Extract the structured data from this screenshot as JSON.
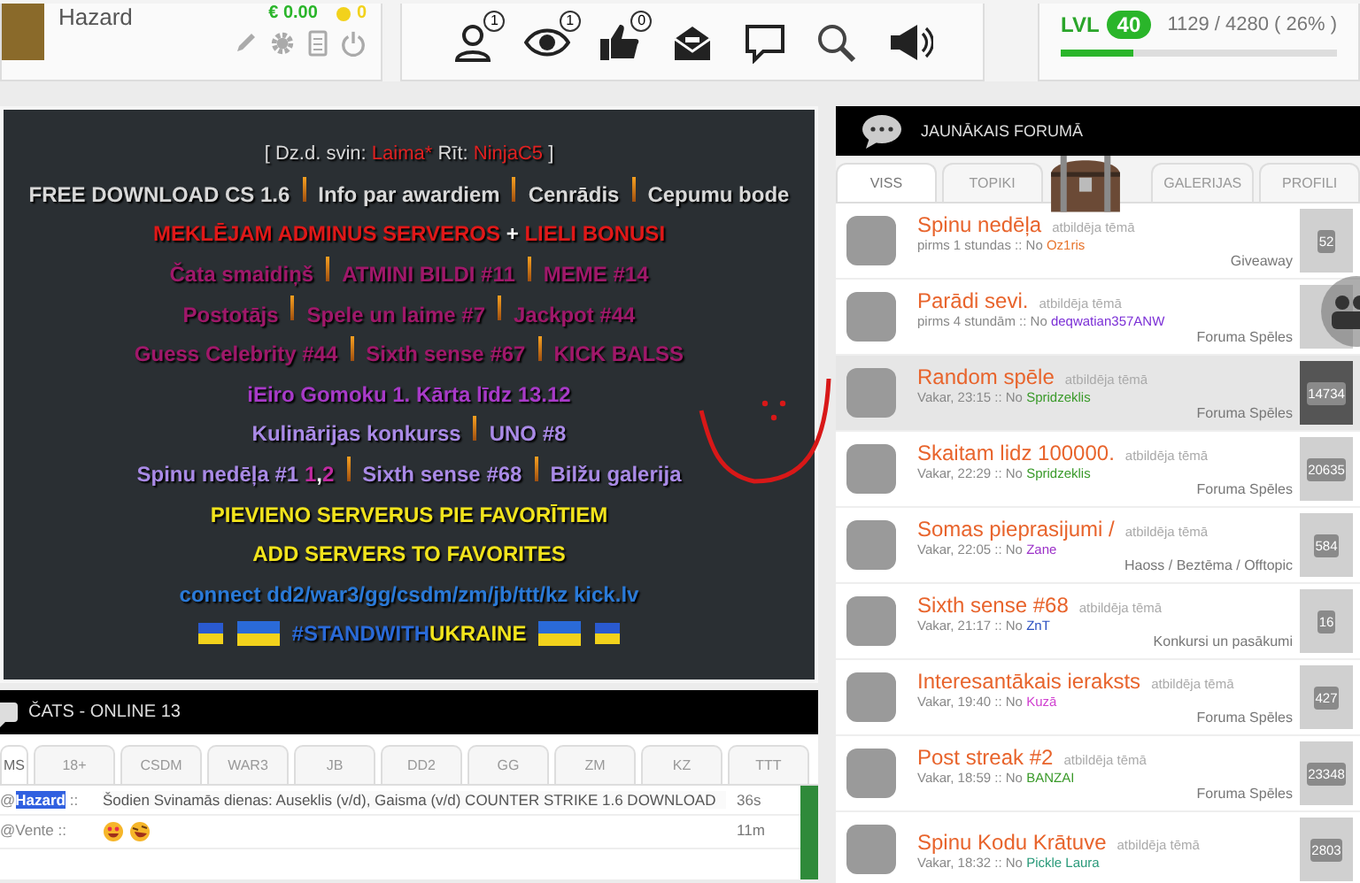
{
  "profile": {
    "name": "Hazard",
    "money": "€ 0.00",
    "coins": "0"
  },
  "nav_icons": [
    {
      "kind": "user",
      "badge": "1"
    },
    {
      "kind": "eye",
      "badge": "1"
    },
    {
      "kind": "like",
      "badge": "0"
    },
    {
      "kind": "mail"
    },
    {
      "kind": "chat"
    },
    {
      "kind": "search"
    },
    {
      "kind": "megaphone"
    }
  ],
  "level_box": {
    "label": "LVL",
    "value": "40",
    "progress": "1129 / 4280 ( 26% )",
    "level": 0.26
  },
  "banner": [
    [
      [
        {
          "text": "[ Dz.d. svin: ",
          "color": "#d8d8d8"
        },
        {
          "text": "Laima*",
          "color": "#e02020"
        },
        {
          "text": " Rīt: ",
          "color": "#d8d8d8"
        },
        {
          "text": "NinjaC5",
          "color": "#e02020"
        },
        {
          "text": " ]",
          "color": "#d8d8d8"
        }
      ]
    ],
    [
      [
        {
          "text": "FREE DOWNLOAD CS 1.6",
          "color": "#d8d8d8"
        }
      ],
      [
        {
          "text": "Info par awardiem",
          "color": "#d8d8d8"
        }
      ],
      [
        {
          "text": "Cenrādis",
          "color": "#d8d8d8"
        }
      ],
      [
        {
          "text": "Cepumu bode",
          "color": "#d8d8d8"
        }
      ]
    ],
    [
      [
        {
          "text": "MEKLĒJAM ADMINUS SERVEROS",
          "color": "#e01818"
        },
        {
          "text": " + ",
          "color": "#ffffff"
        },
        {
          "text": "LIELI BONUSI",
          "color": "#e01818"
        }
      ]
    ],
    [
      [
        {
          "text": "Čata smaidiņš",
          "color": "#a0186a"
        }
      ],
      [
        {
          "text": "ATMINI BILDI #11",
          "color": "#a0186a"
        }
      ],
      [
        {
          "text": "MEME #14",
          "color": "#a0186a"
        }
      ]
    ],
    [
      [
        {
          "text": "Postotājs",
          "color": "#a0186a"
        }
      ],
      [
        {
          "text": "Spele un laime #7",
          "color": "#a0186a"
        }
      ],
      [
        {
          "text": "Jackpot #44",
          "color": "#a0186a"
        }
      ]
    ],
    [
      [
        {
          "text": "Guess Celebrity #44",
          "color": "#a0186a"
        }
      ],
      [
        {
          "text": "Sixth sense #67",
          "color": "#a0186a"
        }
      ],
      [
        {
          "text": "KICK BALSS",
          "color": "#a0186a"
        }
      ]
    ],
    [
      [
        {
          "text": "iEiro Gomoku 1. Kārta līdz 13.12",
          "color": "#a83ac8"
        }
      ]
    ],
    [
      [
        {
          "text": "Kulinārijas konkurss",
          "color": "#a98ae6"
        }
      ],
      [
        {
          "text": "UNO #8",
          "color": "#a98ae6"
        }
      ]
    ],
    [
      [
        {
          "text": "Spinu nedēļa #1 ",
          "color": "#a98ae6"
        },
        {
          "text": "1",
          "color": "#c02aa0"
        },
        {
          "text": ",",
          "color": "#ffffff"
        },
        {
          "text": "2",
          "color": "#c02aa0"
        }
      ],
      [
        {
          "text": "Sixth sense #68",
          "color": "#a98ae6"
        }
      ],
      [
        {
          "text": "Bilžu galerija",
          "color": "#a98ae6"
        }
      ]
    ],
    [
      [
        {
          "text": "PIEVIENO SERVERUS PIE FAVORĪTIEM",
          "color": "#f2e41c"
        }
      ]
    ],
    [
      [
        {
          "text": "ADD SERVERS TO FAVORITES",
          "color": "#f2e41c"
        }
      ]
    ],
    [
      [
        {
          "text": "connect dd2/war3/gg/csdm/zm/jb/ttt/kz kick.lv",
          "color": "#2a7ad8"
        }
      ]
    ]
  ],
  "ukraine": [
    {
      "text": "#STANDWITH",
      "color": "#2a6ad8"
    },
    {
      "text": "UKRAINE",
      "color": "#f2e41c"
    }
  ],
  "chat": {
    "title": "ČATS - ONLINE 13",
    "tabs": [
      {
        "label": "MS",
        "selected": true
      },
      {
        "label": "18+",
        "selected": false
      },
      {
        "label": "CSDM",
        "selected": false
      },
      {
        "label": "WAR3",
        "selected": false
      },
      {
        "label": "JB",
        "selected": false
      },
      {
        "label": "DD2",
        "selected": false
      },
      {
        "label": "GG",
        "selected": false
      },
      {
        "label": "ZM",
        "selected": false
      },
      {
        "label": "KZ",
        "selected": false
      },
      {
        "label": "TTT",
        "selected": false
      }
    ],
    "messages": [
      {
        "prefix": "@",
        "user": "Hazard",
        "suffix": "::",
        "highlighted": true,
        "text": "Šodien Svinamās dienas: Auseklis (v/d), Gaisma (v/d) COUNTER STRIKE 1.6 DOWNLOAD",
        "time": "36s",
        "emojis": false
      },
      {
        "prefix": "@",
        "user": "Vente",
        "suffix": "::",
        "highlighted": false,
        "time": "11m",
        "emojis": true
      }
    ]
  },
  "forum": {
    "title": "JAUNĀKAIS FORUMĀ",
    "tabs": [
      {
        "label": "VISS",
        "selected": true
      },
      {
        "label": "TOPIKI",
        "selected": false
      },
      {
        "label": "GALERIJAS",
        "selected": false
      },
      {
        "label": "PROFILI",
        "selected": false
      }
    ],
    "posts": [
      {
        "title": "Spinu nedēļa",
        "action": "atbildēja tēmā",
        "time": "pirms 1 stundas",
        "by": ":: No",
        "user": "Oz1ris",
        "color": "#e8742c",
        "category": "Giveaway",
        "count": "52",
        "selected": false
      },
      {
        "title": "Parādi sevi.",
        "action": "atbildēja tēmā",
        "time": "pirms 4 stundām",
        "by": ":: No",
        "user": "deqwatian357ANW",
        "color": "#7b2fd6",
        "category": "Foruma Spēles",
        "selected": false
      },
      {
        "title": "Random spēle",
        "action": "atbildēja tēmā",
        "time": "Vakar, 23:15",
        "by": ":: No",
        "user": "Spridzeklis",
        "color": "#3a9a2a",
        "category": "Foruma Spēles",
        "count": "14734",
        "selected": true
      },
      {
        "title": "Skaitam lidz 100000.",
        "action": "atbildēja tēmā",
        "time": "Vakar, 22:29",
        "by": ":: No",
        "user": "Spridzeklis",
        "color": "#3a9a2a",
        "category": "Foruma Spēles",
        "count": "20635",
        "selected": false
      },
      {
        "title": "Somas pieprasijumi /",
        "action": "atbildēja tēmā",
        "time": "Vakar, 22:05",
        "by": ":: No",
        "user": "Zane",
        "color": "#9b30c8",
        "category": "Haoss / Beztēma / Offtopic",
        "count": "584",
        "selected": false
      },
      {
        "title": "Sixth sense #68",
        "action": "atbildēja tēmā",
        "time": "Vakar, 21:17",
        "by": ":: No",
        "user": "ZnT",
        "color": "#2a4fc0",
        "category": "Konkursi un pasākumi",
        "count": "16",
        "selected": false
      },
      {
        "title": "Interesantākais ieraksts",
        "action": "atbildēja tēmā",
        "time": "Vakar, 19:40",
        "by": ":: No",
        "user": "Kuzā",
        "color": "#d040d0",
        "category": "Foruma Spēles",
        "count": "427",
        "selected": false
      },
      {
        "title": "Post streak #2",
        "action": "atbildēja tēmā",
        "time": "Vakar, 18:59",
        "by": ":: No",
        "user": "BANZAI",
        "color": "#3a9a2a",
        "category": "Foruma Spēles",
        "count": "23348",
        "selected": false
      },
      {
        "title": "Spinu Kodu Krātuve",
        "action": "atbildēja tēmā",
        "time": "Vakar, 18:32",
        "by": ":: No",
        "user": "Pickle Laura",
        "color": "#2a9a7a",
        "count": "2803",
        "selected": false
      }
    ]
  }
}
